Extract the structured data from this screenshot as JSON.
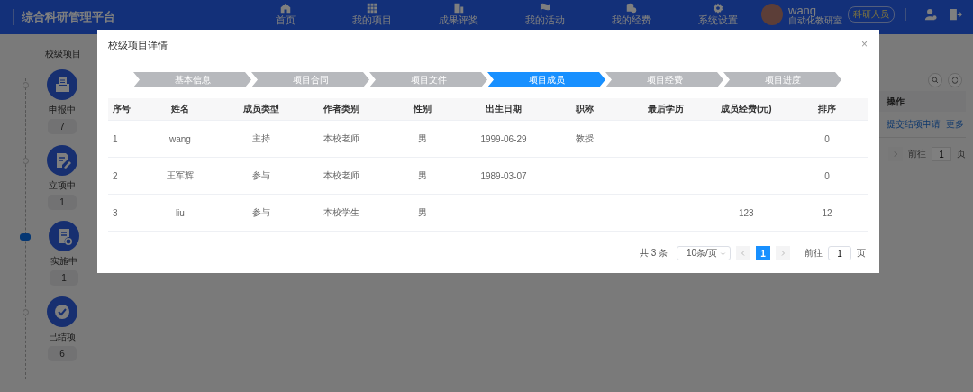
{
  "header": {
    "brand": "综合科研管理平台",
    "nav": [
      {
        "label": "首页"
      },
      {
        "label": "我的项目"
      },
      {
        "label": "成果评奖"
      },
      {
        "label": "我的活动"
      },
      {
        "label": "我的经费"
      },
      {
        "label": "系统设置"
      }
    ],
    "user": {
      "name": "wang",
      "badge": "科研人员",
      "department": "自动化教研室"
    }
  },
  "sidebar": {
    "title": "校级项目",
    "stages": [
      {
        "label": "申报中",
        "count": "7",
        "selected": false
      },
      {
        "label": "立项中",
        "count": "1",
        "selected": false
      },
      {
        "label": "实施中",
        "count": "1",
        "selected": true
      },
      {
        "label": "已结项",
        "count": "6",
        "selected": false
      }
    ]
  },
  "list": {
    "action_column": "操作",
    "actions": [
      "提交结项申请",
      "更多"
    ],
    "pagination": {
      "jump_label": "前往",
      "jump_value": "1",
      "page_suffix": "页"
    }
  },
  "modal": {
    "title": "校级项目详情",
    "close": "×",
    "steps": [
      {
        "label": "基本信息",
        "selected": false
      },
      {
        "label": "项目合同",
        "selected": false
      },
      {
        "label": "项目文件",
        "selected": false
      },
      {
        "label": "项目成员",
        "selected": true
      },
      {
        "label": "项目经费",
        "selected": false
      },
      {
        "label": "项目进度",
        "selected": false
      }
    ],
    "columns": [
      "序号",
      "姓名",
      "成员类型",
      "作者类别",
      "性别",
      "出生日期",
      "职称",
      "最后学历",
      "成员经费(元)",
      "排序"
    ],
    "rows": [
      [
        "1",
        "wang",
        "主持",
        "本校老师",
        "男",
        "1999-06-29",
        "教授",
        "",
        "",
        "0"
      ],
      [
        "2",
        "王军辉",
        "参与",
        "本校老师",
        "男",
        "1989-03-07",
        "",
        "",
        "",
        "0"
      ],
      [
        "3",
        "liu",
        "参与",
        "本校学生",
        "男",
        "",
        "",
        "",
        "123",
        "12"
      ]
    ],
    "pagination": {
      "total": "共 3 条",
      "page_size": "10条/页",
      "pages": [
        {
          "label": "1",
          "selected": true
        }
      ],
      "jump_label": "前往",
      "jump_value": "1",
      "page_suffix": "页"
    }
  }
}
